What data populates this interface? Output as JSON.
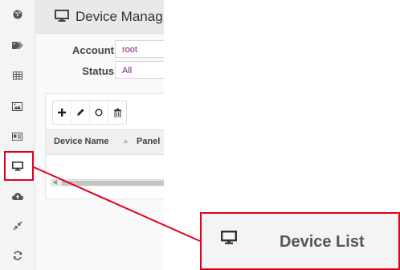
{
  "sidebar": {
    "items": [
      {
        "icon": "globe-icon"
      },
      {
        "icon": "tags-icon"
      },
      {
        "icon": "table-icon"
      },
      {
        "icon": "image-icon"
      },
      {
        "icon": "id-card-icon"
      },
      {
        "icon": "desktop-icon",
        "active": true
      },
      {
        "icon": "cloud-upload-icon"
      },
      {
        "icon": "compress-icon"
      },
      {
        "icon": "refresh-icon"
      }
    ]
  },
  "header": {
    "title": "Device Manag"
  },
  "filters": {
    "account_label": "Account",
    "account_value": "root",
    "status_label": "Status",
    "status_value": "All"
  },
  "table": {
    "columns": [
      "Device Name",
      "Panel"
    ]
  },
  "callout": {
    "label": "Device List"
  },
  "colors": {
    "highlight": "#e0001b",
    "accent": "#7a1e7a"
  }
}
